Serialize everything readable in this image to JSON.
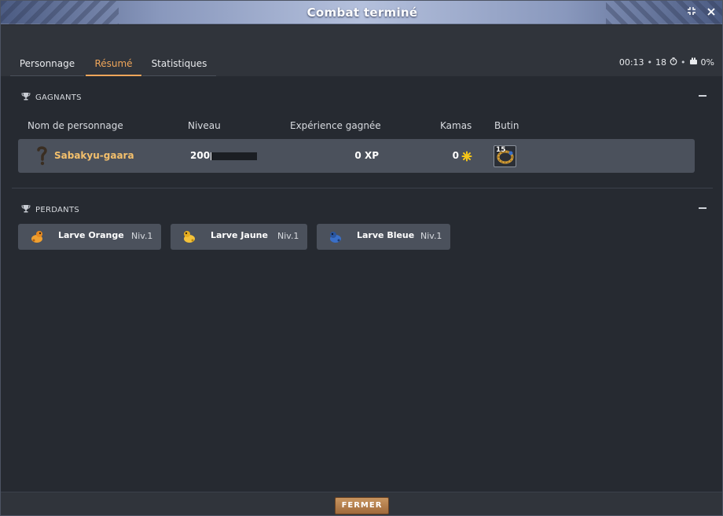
{
  "window": {
    "title": "Combat terminé",
    "controls": {
      "minimize_icon": "collapse-arrows-icon",
      "close_icon": "close-icon"
    }
  },
  "tabs": [
    {
      "label": "Personnage",
      "active": false
    },
    {
      "label": "Résumé",
      "active": true
    },
    {
      "label": "Statistiques",
      "active": false
    }
  ],
  "stats": {
    "duration": "00:13",
    "turns": "18",
    "turns_icon": "clock-icon",
    "percent_icon": "drop-icon",
    "percent": "0%"
  },
  "winners": {
    "heading": "GAGNANTS",
    "heading_icon": "trophy-icon",
    "columns": {
      "name": "Nom de personnage",
      "level": "Niveau",
      "xp": "Expérience gagnée",
      "kamas": "Kamas",
      "loot": "Butin"
    },
    "rows": [
      {
        "name": "Sabakyu-gaara",
        "level": "200",
        "level_progress": 0.02,
        "xp": "0 XP",
        "kamas": "0",
        "kamas_icon": "kama-icon",
        "loot": [
          {
            "count": "15",
            "icon": "larva-ring-icon"
          }
        ]
      }
    ]
  },
  "losers": {
    "heading": "PERDANTS",
    "heading_icon": "trophy-icon",
    "items": [
      {
        "name": "Larve Orange",
        "level": "Niv.1",
        "icon": "orange-larva-icon",
        "color": "#f0a030"
      },
      {
        "name": "Larve Jaune",
        "level": "Niv.1",
        "icon": "yellow-larva-icon",
        "color": "#f4c23a"
      },
      {
        "name": "Larve Bleue",
        "level": "Niv.1",
        "icon": "blue-larva-icon",
        "color": "#3a6fc8"
      }
    ]
  },
  "footer": {
    "close_label": "FERMER"
  },
  "colors": {
    "accent": "#f0a65a",
    "winner_name": "#f4c06c",
    "button": "#b07a48"
  }
}
